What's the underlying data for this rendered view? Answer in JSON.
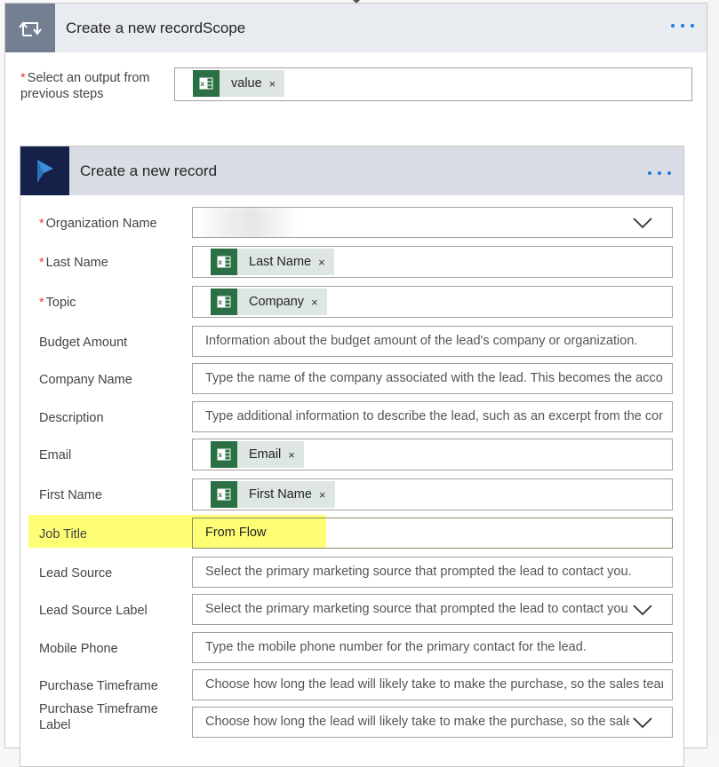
{
  "outer_card": {
    "title": "Create a new recordScope",
    "icon": "scope-loop-icon",
    "more_label": "more-options",
    "output_field": {
      "label": "Select an output from previous steps",
      "required": "*",
      "token": {
        "label": "value",
        "icon": "excel-icon",
        "remove": "×"
      }
    }
  },
  "inner_card": {
    "title": "Create a new record",
    "icon": "dynamics-365-icon",
    "more_label": "more-options",
    "fields": [
      {
        "label": "Organization Name",
        "required": "*",
        "type": "dropdown",
        "value": "",
        "blurred": true
      },
      {
        "label": "Last Name",
        "required": "*",
        "type": "token",
        "token": "Last Name"
      },
      {
        "label": "Topic",
        "required": "*",
        "type": "token",
        "token": "Company"
      },
      {
        "label": "Budget Amount",
        "type": "text",
        "placeholder": "Information about the budget amount of the lead's company or organization."
      },
      {
        "label": "Company Name",
        "type": "text",
        "placeholder": "Type the name of the company associated with the lead. This becomes the account name"
      },
      {
        "label": "Description",
        "type": "text",
        "placeholder": "Type additional information to describe the lead, such as an excerpt from the company's website"
      },
      {
        "label": "Email",
        "type": "token",
        "token": "Email"
      },
      {
        "label": "First Name",
        "type": "token",
        "token": "First Name"
      },
      {
        "label": "Job Title",
        "type": "text",
        "value": "From Flow",
        "highlighted": true
      },
      {
        "label": "Lead Source",
        "type": "text",
        "placeholder": "Select the primary marketing source that prompted the lead to contact you."
      },
      {
        "label": "Lead Source Label",
        "type": "dropdown",
        "placeholder": "Select the primary marketing source that prompted the lead to contact you."
      },
      {
        "label": "Mobile Phone",
        "type": "text",
        "placeholder": "Type the mobile phone number for the primary contact for the lead."
      },
      {
        "label": "Purchase Timeframe",
        "type": "text",
        "placeholder": "Choose how long the lead will likely take to make the purchase, so the sales team"
      },
      {
        "label": "Purchase Timeframe Label",
        "type": "dropdown",
        "placeholder": "Choose how long the lead will likely take to make the purchase, so the sales team"
      }
    ]
  },
  "colors": {
    "accent_dots": "#1f7ae0",
    "excel_green": "#2a7044",
    "token_bg": "#dde6e1",
    "dynamics_navy": "#16214a",
    "highlight": "#ffff5e",
    "required": "#e04040"
  }
}
